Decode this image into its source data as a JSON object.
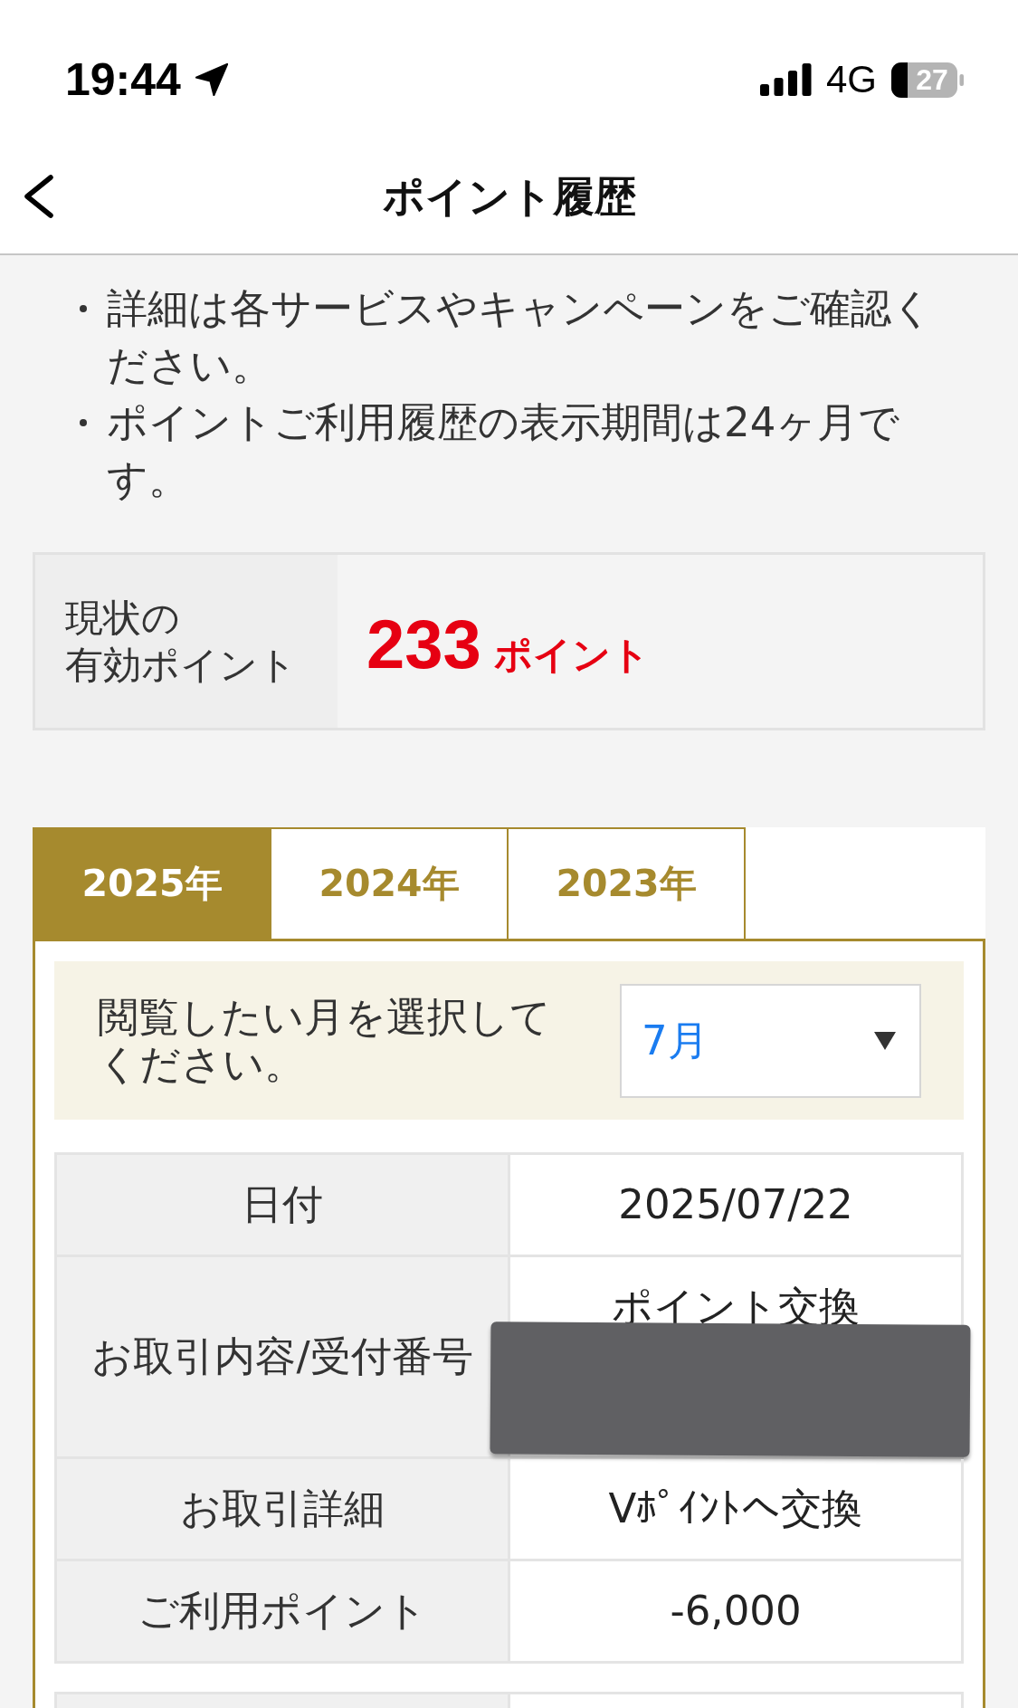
{
  "status_bar": {
    "time": "19:44",
    "network": "4G",
    "battery": "27"
  },
  "header": {
    "title": "ポイント履歴"
  },
  "notes": [
    "詳細は各サービスやキャンペーンをご確認ください。",
    "ポイントご利用履歴の表示期間は24ヶ月です。"
  ],
  "balance": {
    "label_lines": [
      "現状の",
      "有効ポイント"
    ],
    "value": "233",
    "unit": "ポイント"
  },
  "tabs": [
    {
      "label": "2025年",
      "selected": true
    },
    {
      "label": "2024年",
      "selected": false
    },
    {
      "label": "2023年",
      "selected": false
    }
  ],
  "month_filter": {
    "label": "閲覧したい月を選択してください。",
    "value": "7月"
  },
  "transactions": [
    {
      "rows": [
        {
          "label": "日付",
          "value": "2025/07/22",
          "redacted": false
        },
        {
          "label": "お取引内容/受付番号",
          "value": "ポイント交換",
          "redacted": true
        },
        {
          "label": "お取引詳細",
          "value": "Vﾎﾟｲﾝﾄへ交換",
          "redacted": false
        },
        {
          "label": "ご利用ポイント",
          "value": "-6,000",
          "redacted": false
        }
      ]
    }
  ]
}
